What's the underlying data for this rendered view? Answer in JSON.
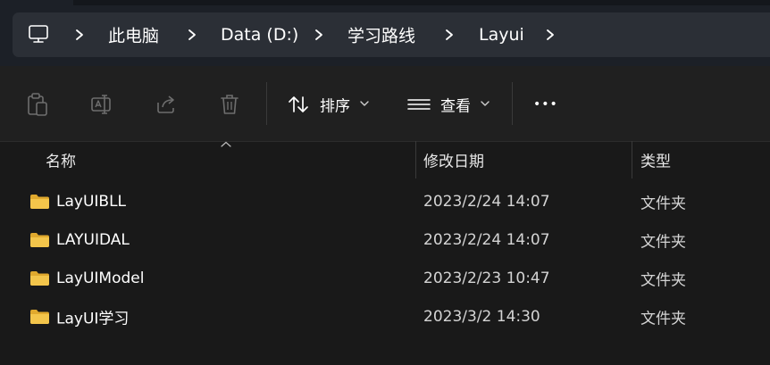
{
  "breadcrumb": {
    "items": [
      "此电脑",
      "Data (D:)",
      "学习路线",
      "Layui"
    ]
  },
  "toolbar": {
    "paste_icon": "clipboard-icon",
    "rename_icon": "rename-icon",
    "share_icon": "share-icon",
    "delete_icon": "trash-icon",
    "sort_label": "排序",
    "view_label": "查看",
    "more_label": "•••"
  },
  "columns": {
    "name": "名称",
    "modified": "修改日期",
    "type": "类型"
  },
  "files": [
    {
      "name": "LayUIBLL",
      "modified": "2023/2/24 14:07",
      "type": "文件夹"
    },
    {
      "name": "LAYUIDAL",
      "modified": "2023/2/24 14:07",
      "type": "文件夹"
    },
    {
      "name": "LayUIModel",
      "modified": "2023/2/23 10:47",
      "type": "文件夹"
    },
    {
      "name": "LayUI学习",
      "modified": "2023/3/2 14:30",
      "type": "文件夹"
    }
  ],
  "colors": {
    "folder": "#f3c54b",
    "background": "#191919",
    "address_bg": "#2b2f36"
  }
}
